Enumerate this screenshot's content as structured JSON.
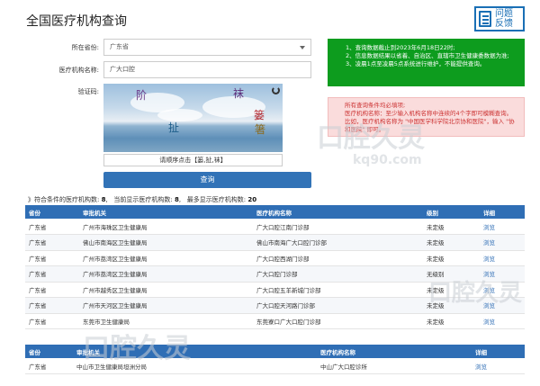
{
  "header": {
    "title": "全国医疗机构查询",
    "feedback_label": "问题反馈"
  },
  "form": {
    "province_label": "所在省份:",
    "province_value": "广东省",
    "name_label": "医疗机构名称:",
    "name_value": "广大口腔",
    "captcha_label": "验证码:",
    "captcha_chars": [
      "阶",
      "袜",
      "扯",
      "篓",
      "箸"
    ],
    "captcha_hint": "请顺序点击【篓,扯,袜】",
    "submit_label": "查询"
  },
  "notice_green": [
    "1、查询数据截止到2023年6月18日22时;",
    "2、信息数据结果以省着、自治区、直辖市卫生健康委数据为准;",
    "3、凌晨1点至凌晨5点系统进行维护，不能提供查询。"
  ],
  "notice_red": [
    "所有查询条件均必填项;",
    "医疗机构名称：至少输入机构名称中连续的4个字即可模糊查询。比如，医疗机构名称为 \"中国医学科学院北京协和医院\"，输入 \"协和医院\" 即可。"
  ],
  "summary": {
    "prefix": "》符合条件的医疗机构数:",
    "matched": "8",
    "shown_label": "当前显示医疗机构数:",
    "shown": "8",
    "max_label": "最多显示医疗机构数:",
    "max": "20"
  },
  "table1": {
    "headers": [
      "省份",
      "审批机关",
      "医疗机构名称",
      "级别",
      "详细"
    ],
    "rows": [
      [
        "广东省",
        "广州市海珠区卫生健康局",
        "广大口腔江南门诊部",
        "未定级",
        "浏览"
      ],
      [
        "广东省",
        "佛山市南海区卫生健康局",
        "佛山市南海广大口腔门诊部",
        "未定级",
        "浏览"
      ],
      [
        "广东省",
        "广州市荔湾区卫生健康局",
        "广大口腔西湖门诊部",
        "未定级",
        "浏览"
      ],
      [
        "广东省",
        "广州市荔湾区卫生健康局",
        "广大口腔门诊部",
        "无级别",
        "浏览"
      ],
      [
        "广东省",
        "广州市越秀区卫生健康局",
        "广大口腔五羊新城门诊部",
        "未定级",
        "浏览"
      ],
      [
        "广东省",
        "广州市天河区卫生健康局",
        "广大口腔天河路门诊部",
        "未定级",
        "浏览"
      ],
      [
        "广东省",
        "东莞市卫生健康局",
        "东莞寮口广大口腔门诊部",
        "未定级",
        "浏览"
      ]
    ]
  },
  "table2": {
    "headers": [
      "省份",
      "审批机关",
      "医疗机构名称",
      "详细"
    ],
    "rows": [
      [
        "广东省",
        "中山市卫生健康局坦洲分局",
        "中山广大口腔诊所",
        "浏览"
      ]
    ]
  },
  "watermark": {
    "brand": "口腔久灵",
    "domain": "kq90.com"
  },
  "colors": {
    "primary": "#2f6eb5",
    "notice_green": "#0d9c1e",
    "notice_red_bg": "#fadcdc"
  }
}
